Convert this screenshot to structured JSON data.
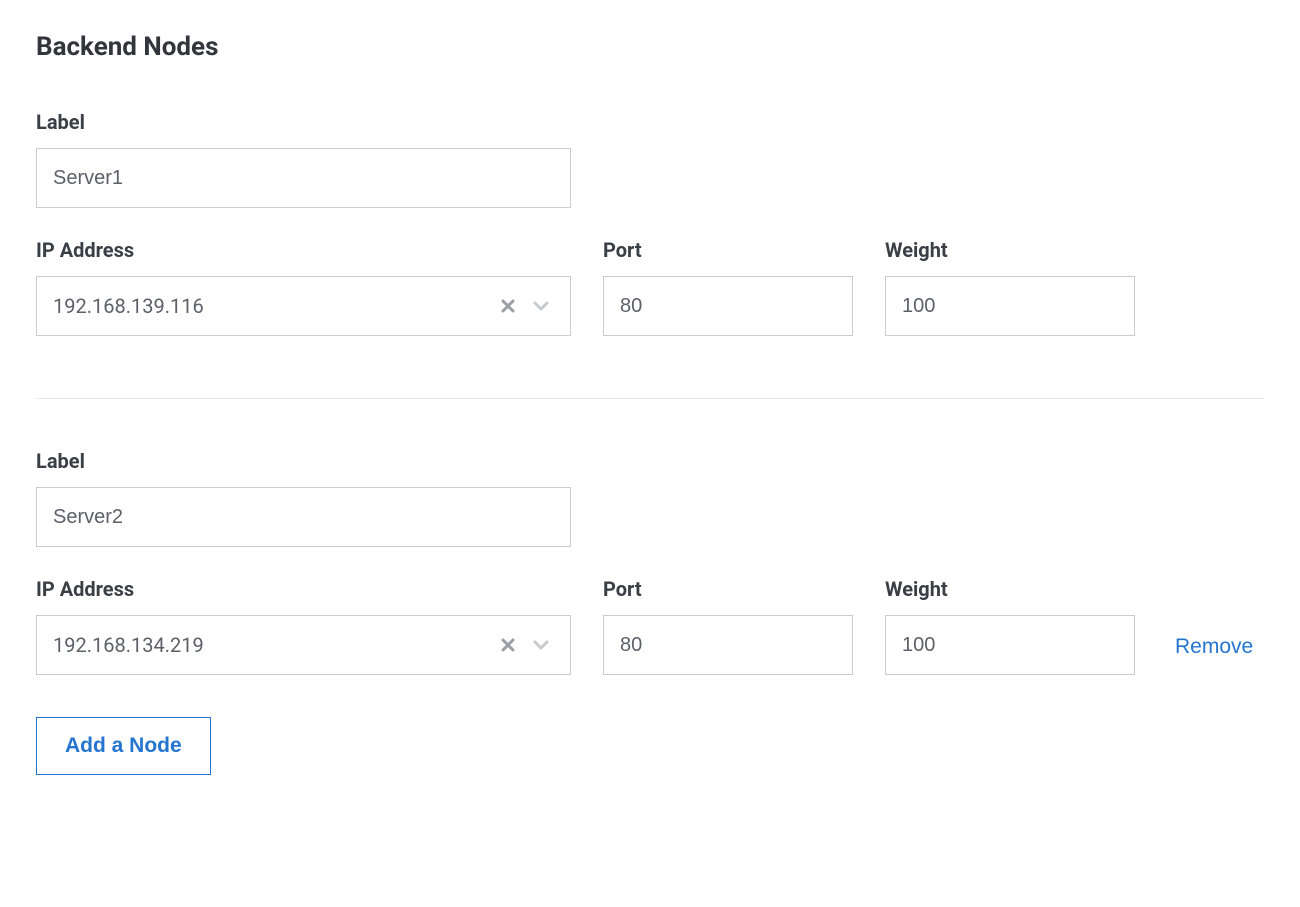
{
  "section_title": "Backend Nodes",
  "labels": {
    "label": "Label",
    "ip_address": "IP Address",
    "port": "Port",
    "weight": "Weight"
  },
  "nodes": [
    {
      "label": "Server1",
      "ip": "192.168.139.116",
      "port": "80",
      "weight": "100",
      "removable": false
    },
    {
      "label": "Server2",
      "ip": "192.168.134.219",
      "port": "80",
      "weight": "100",
      "removable": true
    }
  ],
  "actions": {
    "remove": "Remove",
    "add_node": "Add a Node"
  }
}
